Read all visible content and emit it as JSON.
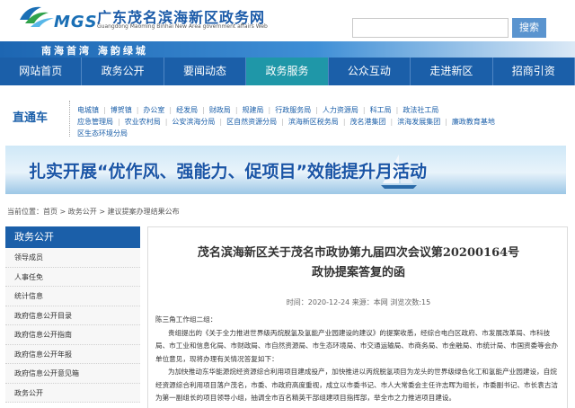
{
  "header": {
    "logo_text": "MGS",
    "site_title_cn": "广东茂名滨海新区政务网",
    "site_title_en": "Guangdong Maoming Binhai New Area government affairs Web",
    "search_placeholder": "",
    "search_button": "搜索",
    "slogan": "南海首湾  海韵绿城"
  },
  "nav": {
    "items": [
      "网站首页",
      "政务公开",
      "要闻动态",
      "政务服务",
      "公众互动",
      "走进新区",
      "招商引资"
    ],
    "active_index": 3
  },
  "direct": {
    "title": "直通车",
    "links": [
      "电城镇",
      "博贺镇",
      "办公室",
      "经发局",
      "财政局",
      "规建局",
      "行政服务局",
      "人力资源局",
      "科工局",
      "政法社工局",
      "应急管理局",
      "农业农村局",
      "公安滨海分局",
      "区自然资源分局",
      "滨海新区税务局",
      "茂名港集团",
      "滨海发展集团",
      "廉政教育基地",
      "区生态环境分局"
    ]
  },
  "banner": {
    "text": "扎实开展“优作风、强能力、促项目”效能提升月活动"
  },
  "breadcrumb": "当前位置：首页 > 政务公开 > 建议提案办理结果公布",
  "sidebar": {
    "heading": "政务公开",
    "items": [
      "领导成员",
      "人事任免",
      "统计信息",
      "政府信息公开目录",
      "政府信息公开指南",
      "政府信息公开年报",
      "政府信息公开意见箱",
      "政务公开"
    ]
  },
  "article": {
    "title_line1": "茂名滨海新区关于茂名市政协第九届四次会议第20200164号",
    "title_line2": "政协提案答复的函",
    "meta": "时间：2020-12-24    来源：本网  浏览次数:15",
    "salutation": "陈三角工作组二组：",
    "para1": "贵组提出的《关于全力推进世界级丙烷脱氢及氢能产业园建设的建议》的提案收悉，经综合电白区政府、市发展改革局、市科技局、市工业和信息化局、市财政局、市自然资源局、市生态环境局、市交通运输局、市商务局、市金融局、市统计局、市国资委等会办单位意见，现将办理有关情况答复如下：",
    "para2": "为加快推动东华能源烷经资源综合利用项目建成投产，加快推进以丙烷脱氢项目为龙头的世界级绿色化工和氢能产业园建设，自烷经资源综合利用项目落户茂名，市委、市政府高度重视，成立以市委书记、市人大常委会主任许志晖为组长，市委副书记、市长袁古洁为第一副组长的项目领导小组，抽调全市百名精英干部组建项目指挥部，举全市之力推进项目建设。"
  },
  "colors": {
    "nav_blue": "#1b5fa9",
    "nav_active": "#1f97a8",
    "search_button": "#5a94cf"
  }
}
